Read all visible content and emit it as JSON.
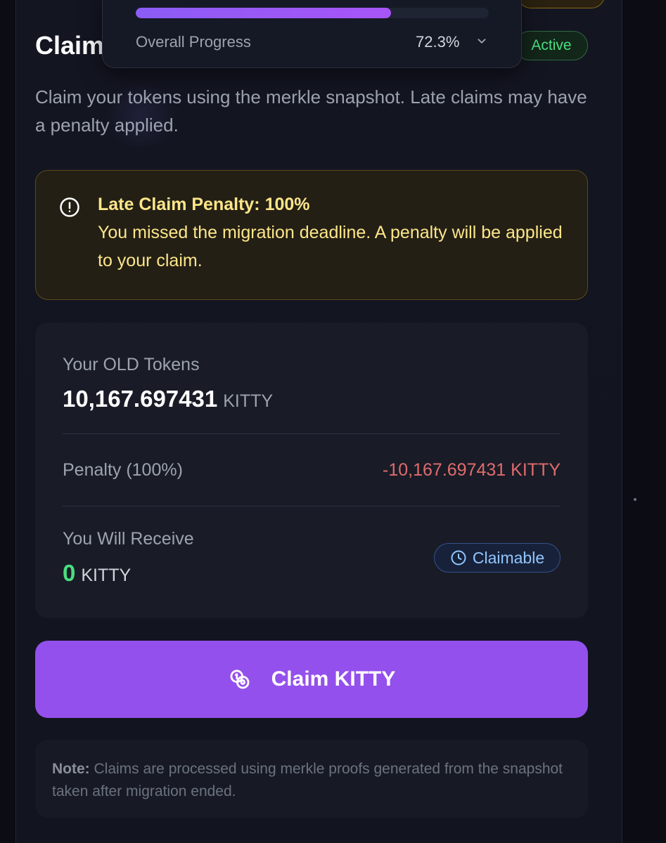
{
  "header": {
    "title": "Claim",
    "status_badge": "Active"
  },
  "subtitle": "Claim your tokens using the merkle snapshot. Late claims may have a penalty applied.",
  "progress_popup": {
    "label": "Overall Progress",
    "value_text": "72.3%",
    "fraction": 0.723,
    "fill_color": "#8b5cf6"
  },
  "alert": {
    "icon": "exclamation-circle-icon",
    "title": "Late Claim Penalty: 100%",
    "body": "You missed the migration deadline. A penalty will be applied to your claim."
  },
  "summary": {
    "old_tokens_label": "Your OLD Tokens",
    "old_tokens_amount": "10,167.697431",
    "old_tokens_unit": "KITTY",
    "penalty_label": "Penalty (100%)",
    "penalty_amount": "-10,167.697431 KITTY",
    "receive_label": "You Will Receive",
    "receive_amount": "0",
    "receive_unit": "KITTY",
    "claimable_badge": "Claimable",
    "claimable_icon": "clock-icon"
  },
  "claim_button": {
    "label": "Claim KITTY",
    "icon": "coins-icon"
  },
  "note": {
    "prefix": "Note:",
    "text": " Claims are processed using merkle proofs generated from the snapshot taken after migration ended."
  },
  "colors": {
    "accent": "#9450ec",
    "success": "#4ade80",
    "danger": "#e06c6c",
    "warning": "#fde68a",
    "info": "#93c5fd"
  }
}
